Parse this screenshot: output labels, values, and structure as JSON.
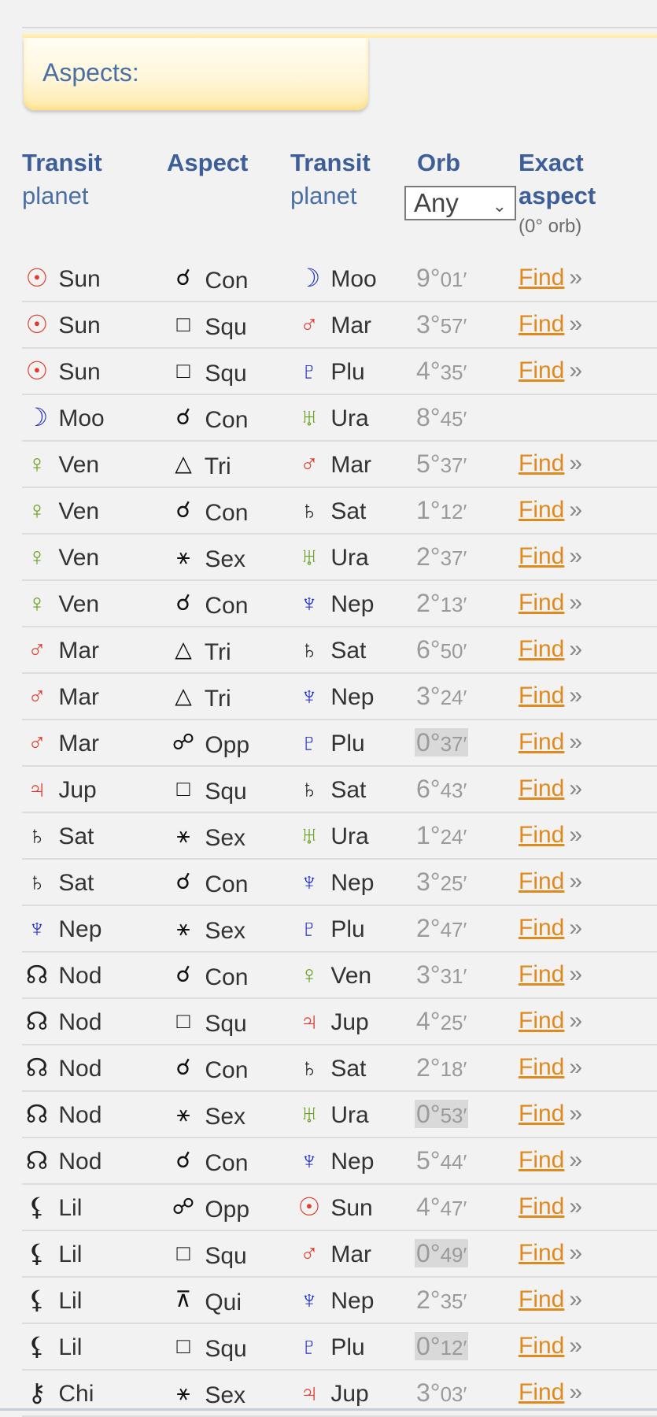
{
  "section_title": "Aspects:",
  "headers": {
    "col1_bold": "Transit",
    "col1_sub": "planet",
    "col2_bold": "Aspect",
    "col3_bold": "Transit",
    "col3_sub": "planet",
    "col4_bold": "Orb",
    "col5_bold": "Exact",
    "col5_bold2": "aspect",
    "col5_sub": "(0° orb)"
  },
  "orb_filter": {
    "selected": "Any"
  },
  "find_label": "Find",
  "raquo": "»",
  "colors": {
    "red": "#e23b2e",
    "green": "#6aa022",
    "blue": "#2432c8",
    "dark": "#222222",
    "find": "#e08a1e"
  },
  "rows": [
    {
      "p1": {
        "glyph": "☉",
        "name": "Sun",
        "color": "#e23b2e",
        "icon": "sun-icon"
      },
      "aspect": {
        "glyph": "☌",
        "name": "Con",
        "icon": "conjunction-icon"
      },
      "p2": {
        "glyph": "☽",
        "name": "Moo",
        "color": "#2432c8",
        "icon": "moon-icon"
      },
      "orb_deg": "9°",
      "orb_min": "01′",
      "highlight": false,
      "find": true
    },
    {
      "p1": {
        "glyph": "☉",
        "name": "Sun",
        "color": "#e23b2e",
        "icon": "sun-icon"
      },
      "aspect": {
        "glyph": "□",
        "name": "Squ",
        "icon": "square-icon"
      },
      "p2": {
        "glyph": "♂",
        "name": "Mar",
        "color": "#e23b2e",
        "icon": "mars-icon"
      },
      "orb_deg": "3°",
      "orb_min": "57′",
      "highlight": false,
      "find": true
    },
    {
      "p1": {
        "glyph": "☉",
        "name": "Sun",
        "color": "#e23b2e",
        "icon": "sun-icon"
      },
      "aspect": {
        "glyph": "□",
        "name": "Squ",
        "icon": "square-icon"
      },
      "p2": {
        "glyph": "♇",
        "name": "Plu",
        "color": "#2432c8",
        "icon": "pluto-icon"
      },
      "orb_deg": "4°",
      "orb_min": "35′",
      "highlight": false,
      "find": true
    },
    {
      "p1": {
        "glyph": "☽",
        "name": "Moo",
        "color": "#2432c8",
        "icon": "moon-icon"
      },
      "aspect": {
        "glyph": "☌",
        "name": "Con",
        "icon": "conjunction-icon"
      },
      "p2": {
        "glyph": "♅",
        "name": "Ura",
        "color": "#6aa022",
        "icon": "uranus-icon"
      },
      "orb_deg": "8°",
      "orb_min": "45′",
      "highlight": false,
      "find": false
    },
    {
      "p1": {
        "glyph": "♀",
        "name": "Ven",
        "color": "#6aa022",
        "icon": "venus-icon"
      },
      "aspect": {
        "glyph": "△",
        "name": "Tri",
        "icon": "trine-icon"
      },
      "p2": {
        "glyph": "♂",
        "name": "Mar",
        "color": "#e23b2e",
        "icon": "mars-icon"
      },
      "orb_deg": "5°",
      "orb_min": "37′",
      "highlight": false,
      "find": true
    },
    {
      "p1": {
        "glyph": "♀",
        "name": "Ven",
        "color": "#6aa022",
        "icon": "venus-icon"
      },
      "aspect": {
        "glyph": "☌",
        "name": "Con",
        "icon": "conjunction-icon"
      },
      "p2": {
        "glyph": "♄",
        "name": "Sat",
        "color": "#222222",
        "icon": "saturn-icon"
      },
      "orb_deg": "1°",
      "orb_min": "12′",
      "highlight": false,
      "find": true
    },
    {
      "p1": {
        "glyph": "♀",
        "name": "Ven",
        "color": "#6aa022",
        "icon": "venus-icon"
      },
      "aspect": {
        "glyph": "⚹",
        "name": "Sex",
        "icon": "sextile-icon"
      },
      "p2": {
        "glyph": "♅",
        "name": "Ura",
        "color": "#6aa022",
        "icon": "uranus-icon"
      },
      "orb_deg": "2°",
      "orb_min": "37′",
      "highlight": false,
      "find": true
    },
    {
      "p1": {
        "glyph": "♀",
        "name": "Ven",
        "color": "#6aa022",
        "icon": "venus-icon"
      },
      "aspect": {
        "glyph": "☌",
        "name": "Con",
        "icon": "conjunction-icon"
      },
      "p2": {
        "glyph": "♆",
        "name": "Nep",
        "color": "#2432c8",
        "icon": "neptune-icon"
      },
      "orb_deg": "2°",
      "orb_min": "13′",
      "highlight": false,
      "find": true
    },
    {
      "p1": {
        "glyph": "♂",
        "name": "Mar",
        "color": "#e23b2e",
        "icon": "mars-icon"
      },
      "aspect": {
        "glyph": "△",
        "name": "Tri",
        "icon": "trine-icon"
      },
      "p2": {
        "glyph": "♄",
        "name": "Sat",
        "color": "#222222",
        "icon": "saturn-icon"
      },
      "orb_deg": "6°",
      "orb_min": "50′",
      "highlight": false,
      "find": true
    },
    {
      "p1": {
        "glyph": "♂",
        "name": "Mar",
        "color": "#e23b2e",
        "icon": "mars-icon"
      },
      "aspect": {
        "glyph": "△",
        "name": "Tri",
        "icon": "trine-icon"
      },
      "p2": {
        "glyph": "♆",
        "name": "Nep",
        "color": "#2432c8",
        "icon": "neptune-icon"
      },
      "orb_deg": "3°",
      "orb_min": "24′",
      "highlight": false,
      "find": true
    },
    {
      "p1": {
        "glyph": "♂",
        "name": "Mar",
        "color": "#e23b2e",
        "icon": "mars-icon"
      },
      "aspect": {
        "glyph": "☍",
        "name": "Opp",
        "icon": "opposition-icon"
      },
      "p2": {
        "glyph": "♇",
        "name": "Plu",
        "color": "#2432c8",
        "icon": "pluto-icon"
      },
      "orb_deg": "0°",
      "orb_min": "37′",
      "highlight": true,
      "find": true
    },
    {
      "p1": {
        "glyph": "♃",
        "name": "Jup",
        "color": "#e23b2e",
        "icon": "jupiter-icon"
      },
      "aspect": {
        "glyph": "□",
        "name": "Squ",
        "icon": "square-icon"
      },
      "p2": {
        "glyph": "♄",
        "name": "Sat",
        "color": "#222222",
        "icon": "saturn-icon"
      },
      "orb_deg": "6°",
      "orb_min": "43′",
      "highlight": false,
      "find": true
    },
    {
      "p1": {
        "glyph": "♄",
        "name": "Sat",
        "color": "#222222",
        "icon": "saturn-icon"
      },
      "aspect": {
        "glyph": "⚹",
        "name": "Sex",
        "icon": "sextile-icon"
      },
      "p2": {
        "glyph": "♅",
        "name": "Ura",
        "color": "#6aa022",
        "icon": "uranus-icon"
      },
      "orb_deg": "1°",
      "orb_min": "24′",
      "highlight": false,
      "find": true
    },
    {
      "p1": {
        "glyph": "♄",
        "name": "Sat",
        "color": "#222222",
        "icon": "saturn-icon"
      },
      "aspect": {
        "glyph": "☌",
        "name": "Con",
        "icon": "conjunction-icon"
      },
      "p2": {
        "glyph": "♆",
        "name": "Nep",
        "color": "#2432c8",
        "icon": "neptune-icon"
      },
      "orb_deg": "3°",
      "orb_min": "25′",
      "highlight": false,
      "find": true
    },
    {
      "p1": {
        "glyph": "♆",
        "name": "Nep",
        "color": "#2432c8",
        "icon": "neptune-icon"
      },
      "aspect": {
        "glyph": "⚹",
        "name": "Sex",
        "icon": "sextile-icon"
      },
      "p2": {
        "glyph": "♇",
        "name": "Plu",
        "color": "#2432c8",
        "icon": "pluto-icon"
      },
      "orb_deg": "2°",
      "orb_min": "47′",
      "highlight": false,
      "find": true
    },
    {
      "p1": {
        "glyph": "☊",
        "name": "Nod",
        "color": "#222222",
        "icon": "node-icon"
      },
      "aspect": {
        "glyph": "☌",
        "name": "Con",
        "icon": "conjunction-icon"
      },
      "p2": {
        "glyph": "♀",
        "name": "Ven",
        "color": "#6aa022",
        "icon": "venus-icon"
      },
      "orb_deg": "3°",
      "orb_min": "31′",
      "highlight": false,
      "find": true
    },
    {
      "p1": {
        "glyph": "☊",
        "name": "Nod",
        "color": "#222222",
        "icon": "node-icon"
      },
      "aspect": {
        "glyph": "□",
        "name": "Squ",
        "icon": "square-icon"
      },
      "p2": {
        "glyph": "♃",
        "name": "Jup",
        "color": "#e23b2e",
        "icon": "jupiter-icon"
      },
      "orb_deg": "4°",
      "orb_min": "25′",
      "highlight": false,
      "find": true
    },
    {
      "p1": {
        "glyph": "☊",
        "name": "Nod",
        "color": "#222222",
        "icon": "node-icon"
      },
      "aspect": {
        "glyph": "☌",
        "name": "Con",
        "icon": "conjunction-icon"
      },
      "p2": {
        "glyph": "♄",
        "name": "Sat",
        "color": "#222222",
        "icon": "saturn-icon"
      },
      "orb_deg": "2°",
      "orb_min": "18′",
      "highlight": false,
      "find": true
    },
    {
      "p1": {
        "glyph": "☊",
        "name": "Nod",
        "color": "#222222",
        "icon": "node-icon"
      },
      "aspect": {
        "glyph": "⚹",
        "name": "Sex",
        "icon": "sextile-icon"
      },
      "p2": {
        "glyph": "♅",
        "name": "Ura",
        "color": "#6aa022",
        "icon": "uranus-icon"
      },
      "orb_deg": "0°",
      "orb_min": "53′",
      "highlight": true,
      "find": true
    },
    {
      "p1": {
        "glyph": "☊",
        "name": "Nod",
        "color": "#222222",
        "icon": "node-icon"
      },
      "aspect": {
        "glyph": "☌",
        "name": "Con",
        "icon": "conjunction-icon"
      },
      "p2": {
        "glyph": "♆",
        "name": "Nep",
        "color": "#2432c8",
        "icon": "neptune-icon"
      },
      "orb_deg": "5°",
      "orb_min": "44′",
      "highlight": false,
      "find": true
    },
    {
      "p1": {
        "glyph": "⚸",
        "name": "Lil",
        "color": "#222222",
        "icon": "lilith-icon"
      },
      "aspect": {
        "glyph": "☍",
        "name": "Opp",
        "icon": "opposition-icon"
      },
      "p2": {
        "glyph": "☉",
        "name": "Sun",
        "color": "#e23b2e",
        "icon": "sun-icon"
      },
      "orb_deg": "4°",
      "orb_min": "47′",
      "highlight": false,
      "find": true
    },
    {
      "p1": {
        "glyph": "⚸",
        "name": "Lil",
        "color": "#222222",
        "icon": "lilith-icon"
      },
      "aspect": {
        "glyph": "□",
        "name": "Squ",
        "icon": "square-icon"
      },
      "p2": {
        "glyph": "♂",
        "name": "Mar",
        "color": "#e23b2e",
        "icon": "mars-icon"
      },
      "orb_deg": "0°",
      "orb_min": "49′",
      "highlight": true,
      "find": true
    },
    {
      "p1": {
        "glyph": "⚸",
        "name": "Lil",
        "color": "#222222",
        "icon": "lilith-icon"
      },
      "aspect": {
        "glyph": "⊼",
        "name": "Qui",
        "icon": "quincunx-icon"
      },
      "p2": {
        "glyph": "♆",
        "name": "Nep",
        "color": "#2432c8",
        "icon": "neptune-icon"
      },
      "orb_deg": "2°",
      "orb_min": "35′",
      "highlight": false,
      "find": true
    },
    {
      "p1": {
        "glyph": "⚸",
        "name": "Lil",
        "color": "#222222",
        "icon": "lilith-icon"
      },
      "aspect": {
        "glyph": "□",
        "name": "Squ",
        "icon": "square-icon"
      },
      "p2": {
        "glyph": "♇",
        "name": "Plu",
        "color": "#2432c8",
        "icon": "pluto-icon"
      },
      "orb_deg": "0°",
      "orb_min": "12′",
      "highlight": true,
      "find": true
    },
    {
      "p1": {
        "glyph": "⚷",
        "name": "Chi",
        "color": "#222222",
        "icon": "chiron-icon"
      },
      "aspect": {
        "glyph": "⚹",
        "name": "Sex",
        "icon": "sextile-icon"
      },
      "p2": {
        "glyph": "♃",
        "name": "Jup",
        "color": "#e23b2e",
        "icon": "jupiter-icon"
      },
      "orb_deg": "3°",
      "orb_min": "03′",
      "highlight": false,
      "find": true
    }
  ]
}
